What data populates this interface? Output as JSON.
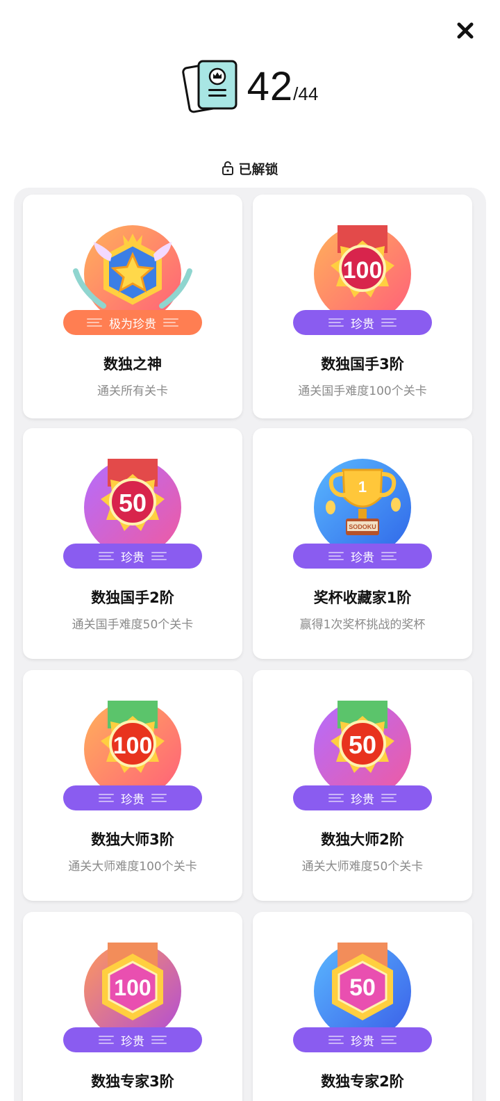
{
  "header": {
    "unlocked_count": "42",
    "total_count": "/44",
    "book_icon": "achievement-book-icon"
  },
  "section": {
    "label": "已解锁",
    "icon": "unlock-icon"
  },
  "close": {
    "icon": "close-icon"
  },
  "achievements": [
    {
      "title": "数独之神",
      "desc": "通关所有关卡",
      "rarity": "极为珍贵",
      "badge_text": "",
      "badge_icon": "star-crest-icon",
      "accent": "#ff7e52"
    },
    {
      "title": "数独国手3阶",
      "desc": "通关国手难度100个关卡",
      "rarity": "珍贵",
      "badge_text": "100",
      "badge_icon": "medal-icon",
      "accent": "#8a5cf0"
    },
    {
      "title": "数独国手2阶",
      "desc": "通关国手难度50个关卡",
      "rarity": "珍贵",
      "badge_text": "50",
      "badge_icon": "medal-icon",
      "accent": "#8a5cf0"
    },
    {
      "title": "奖杯收藏家1阶",
      "desc": "赢得1次奖杯挑战的奖杯",
      "rarity": "珍贵",
      "badge_text": "1",
      "badge_sub": "SODOKU",
      "badge_icon": "trophy-icon",
      "accent": "#8a5cf0"
    },
    {
      "title": "数独大师3阶",
      "desc": "通关大师难度100个关卡",
      "rarity": "珍贵",
      "badge_text": "100",
      "badge_icon": "medal-icon",
      "accent": "#8a5cf0"
    },
    {
      "title": "数独大师2阶",
      "desc": "通关大师难度50个关卡",
      "rarity": "珍贵",
      "badge_text": "50",
      "badge_icon": "medal-icon",
      "accent": "#8a5cf0"
    },
    {
      "title": "数独专家3阶",
      "desc": "",
      "rarity": "珍贵",
      "badge_text": "100",
      "badge_icon": "hexagon-medal-icon",
      "accent": "#8a5cf0"
    },
    {
      "title": "数独专家2阶",
      "desc": "",
      "rarity": "珍贵",
      "badge_text": "50",
      "badge_icon": "hexagon-medal-icon",
      "accent": "#8a5cf0"
    }
  ]
}
